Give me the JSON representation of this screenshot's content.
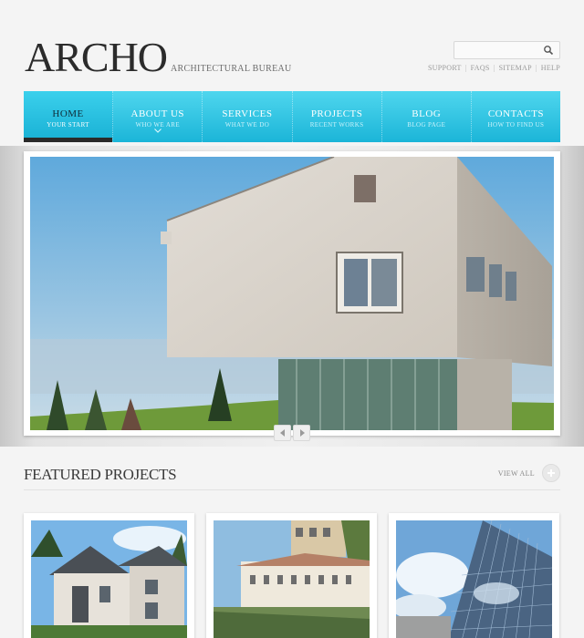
{
  "header": {
    "logo": "ARCHO",
    "tagline": "ARCHITECTURAL BUREAU",
    "search": {
      "placeholder": "",
      "value": ""
    },
    "top_links": [
      "SUPPORT",
      "FAQS",
      "SITEMAP",
      "HELP"
    ]
  },
  "nav": {
    "items": [
      {
        "label": "HOME",
        "sub": "YOUR START",
        "active": true
      },
      {
        "label": "ABOUT US",
        "sub": "WHO WE ARE",
        "active": false
      },
      {
        "label": "SERVICES",
        "sub": "WHAT WE DO",
        "active": false
      },
      {
        "label": "PROJECTS",
        "sub": "RECENT WORKS",
        "active": false
      },
      {
        "label": "BLOG",
        "sub": "BLOG PAGE",
        "active": false
      },
      {
        "label": "CONTACTS",
        "sub": "HOW TO FIND US",
        "active": false
      }
    ]
  },
  "featured": {
    "title": "FEATURED PROJECTS",
    "view_all": "VIEW ALL"
  },
  "colors": {
    "accent": "#1bb5d8",
    "accent_light": "#4fd6ee",
    "active_bar": "#2a2a2a"
  }
}
